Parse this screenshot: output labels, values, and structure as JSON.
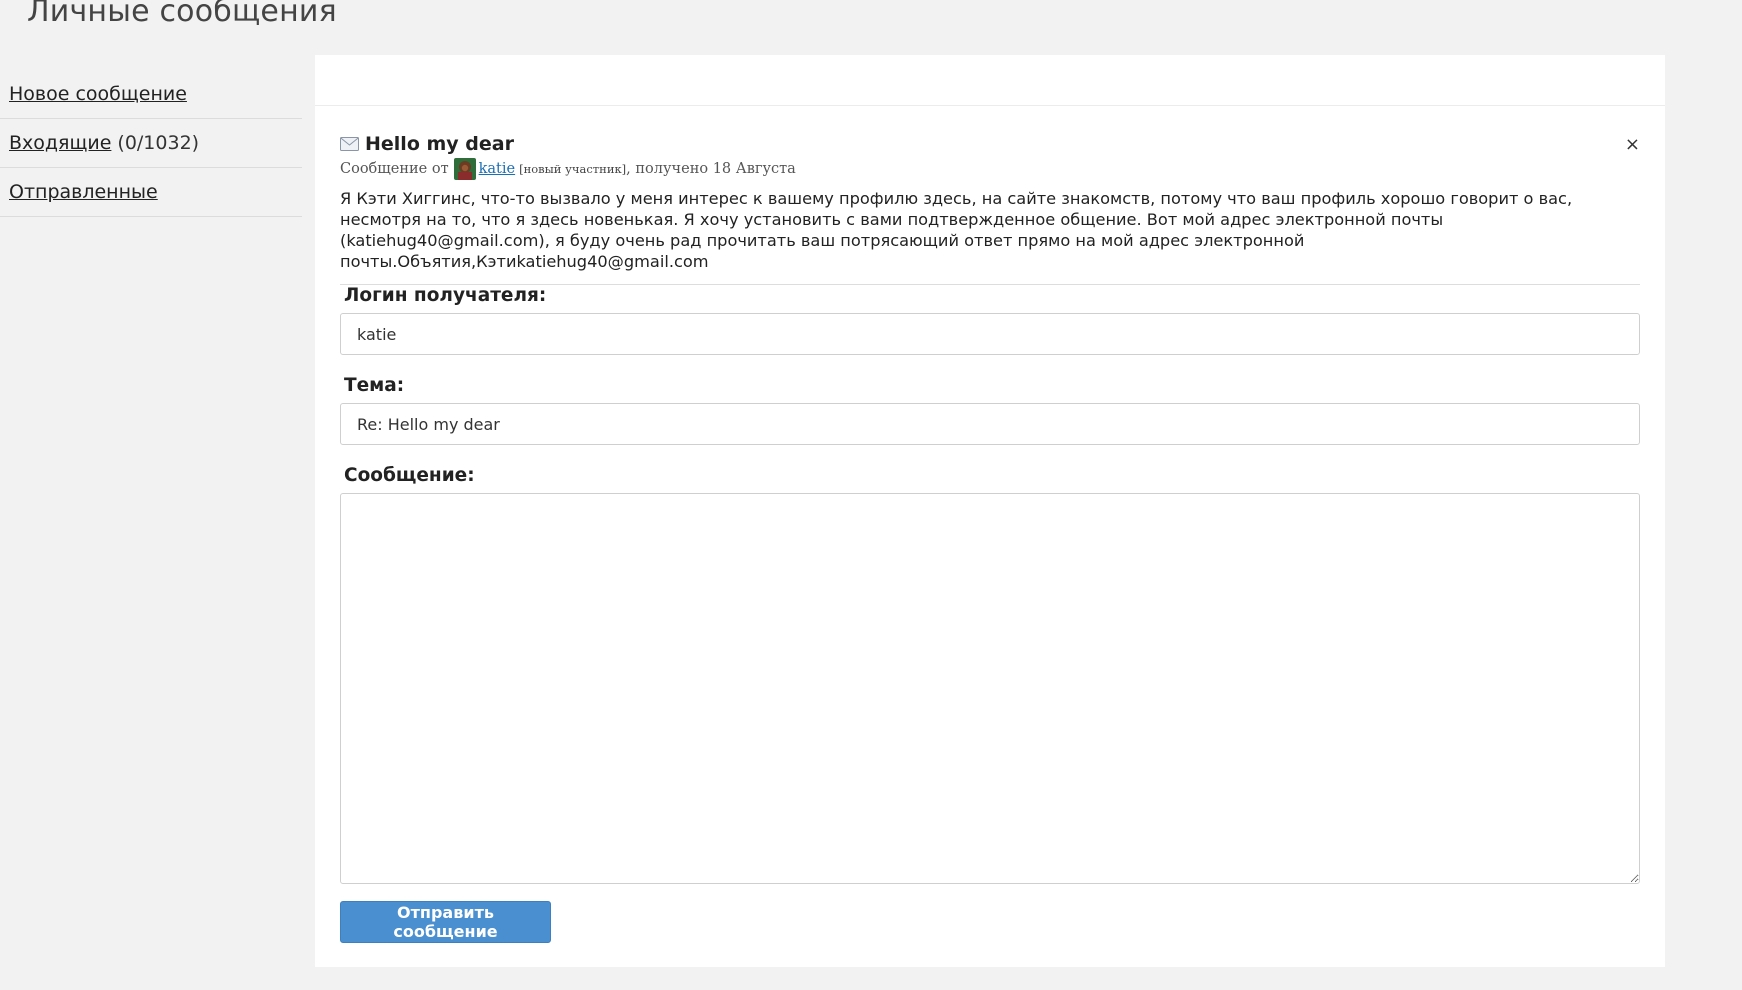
{
  "page": {
    "title": "Личные сообщения"
  },
  "sidebar": {
    "items": [
      {
        "label": "Новое сообщение"
      },
      {
        "label": "Входящие",
        "count": "(0/1032)"
      },
      {
        "label": "Отправленные"
      }
    ]
  },
  "message": {
    "subject": "Hello my dear",
    "close": "×",
    "meta": {
      "prefix": "Сообщение от",
      "sender": "katie",
      "badge": "[новый участник]",
      "received": ", получено 18 Августа"
    },
    "body": "Я Кэти Хиггинс, что-то вызвало у меня интерес к вашему профилю здесь, на сайте знакомств, потому что ваш профиль хорошо говорит о вас, несмотря на то, что я здесь новенькая. Я хочу установить с вами подтвержденное общение. Вот мой адрес электронной почты (katiehug40@gmail.com), я буду очень рад прочитать ваш потрясающий ответ прямо на мой адрес электронной почты.Объятия,Кэтиkatiehug40@gmail.com"
  },
  "form": {
    "recipient_label": "Логин получателя:",
    "recipient_value": "katie",
    "subject_label": "Тема:",
    "subject_value": "Re: Hello my dear",
    "message_label": "Сообщение:",
    "message_value": "",
    "submit_label": "Отправить сообщение"
  },
  "colors": {
    "background": "#f2f2f2",
    "panel": "#ffffff",
    "button": "#4a8fd0",
    "link": "#1a6fb5"
  },
  "icons": {
    "envelope": "envelope-icon",
    "close": "close-icon",
    "avatar": "avatar"
  }
}
